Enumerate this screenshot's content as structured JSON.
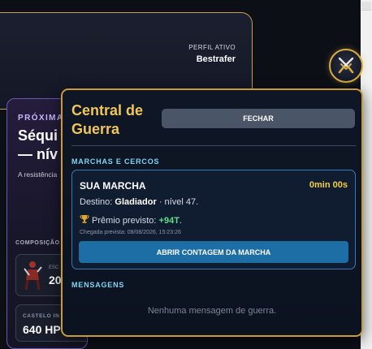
{
  "profile": {
    "label": "PERFIL ATIVO",
    "name": "Bestrafer"
  },
  "mission": {
    "eyebrow": "PRÓXIMA",
    "title": "Séqui\n— nív",
    "description": "A resistência",
    "composition_label": "COMPOSIÇÃO",
    "hero_small": "ESC",
    "hero_value": "20",
    "castle_label": "CASTELO IN",
    "castle_value": "640 HP"
  },
  "war_button": {
    "icon": "crossed-swords-icon"
  },
  "war_panel": {
    "title": "Central de\nGuerra",
    "close_label": "FECHAR",
    "marches_heading": "MARCHAS E CERCOS",
    "march": {
      "title": "SUA MARCHA",
      "timer": "0min 00s",
      "dest_label": "Destino: ",
      "dest_name": "Gladiador",
      "dest_level": " · nível 47.",
      "prize_label": "Prêmio previsto: ",
      "prize_value": "+94T",
      "prize_suffix": ".",
      "eta": "Chegada prevista: 08/08/2026, 15:23:26",
      "open_label": "ABRIR CONTAGEM DA MARCHA"
    },
    "messages_heading": "MENSAGENS",
    "empty_messages": "Nenhuma mensagem de guerra."
  },
  "colors": {
    "gold_border": "#c99a35",
    "title_gold": "#f0c659",
    "section_cyan": "#7fd6f5",
    "timer_yellow": "#f5cf40",
    "prize_green": "#5ee08a",
    "primary_button": "#1d6ea4"
  }
}
